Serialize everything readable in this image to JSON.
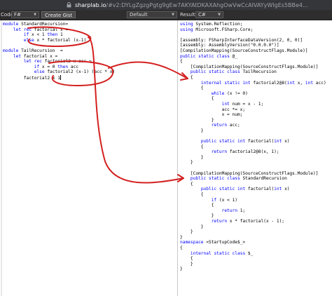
{
  "browser": {
    "url_host": "sharplab.io",
    "url_rest": "/#v2:DYLgZgzgPgtg9gEw7AKYAtDKAXAhgOwVwCcAIVAYyWIgEs5BBe4..."
  },
  "toolbar": {
    "code_label": "Code",
    "code_language": "F#",
    "create_gist_label": "Create Gist",
    "mode": "Default",
    "results_label": "Results",
    "results_language": "C#"
  },
  "left_code": [
    "module StandardRecursion=",
    "    let rec factorial x =",
    "        if x < 1 then 1",
    "        else x * factorial (x-1)",
    "",
    "module TailRecursion  =",
    "    let factorial x =",
    "        let rec factorial2 x acc =",
    "            if x = 0 then acc",
    "            else factorial2 (x-1) (acc * x)",
    "        factorial2 x 1"
  ],
  "right_code": [
    "using System.Reflection;",
    "using Microsoft.FSharp.Core;",
    "",
    "[assembly: FSharpInterfaceDataVersion(2, 0, 0)]",
    "[assembly: AssemblyVersion(\"0.0.0.0\")]",
    "[CompilationMapping(SourceConstructFlags.Module)]",
    "public static class @_",
    "{",
    "    [CompilationMapping(SourceConstructFlags.Module)]",
    "    public static class TailRecursion",
    "    {",
    "        internal static int factorial2@8(int x, int acc)",
    "        {",
    "            while (x != 0)",
    "            {",
    "                int num = x - 1;",
    "                acc *= x;",
    "                x = num;",
    "            }",
    "            return acc;",
    "        }",
    "",
    "        public static int factorial(int x)",
    "        {",
    "            return factorial2@8(x, 1);",
    "        }",
    "    }",
    "",
    "    [CompilationMapping(SourceConstructFlags.Module)]",
    "    public static class StandardRecursion",
    "    {",
    "        public static int factorial(int x)",
    "        {",
    "            if (x < 1)",
    "            {",
    "                return 1;",
    "            }",
    "            return x * factorial(x - 1);",
    "        }",
    "    }",
    "}",
    "namespace <StartupCode$_>",
    "{",
    "    internal static class $_",
    "    {",
    "    }",
    "}"
  ],
  "colors": {
    "annotation": "#d42020",
    "keyword": "#0000ff",
    "toolbar_bg": "#2e2e2e"
  },
  "icons": {
    "lock": "lock-icon",
    "dropdown": "chevron-down-icon"
  }
}
